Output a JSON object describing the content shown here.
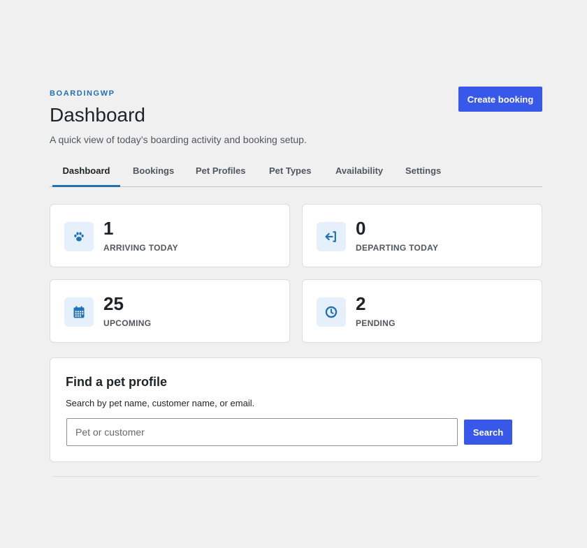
{
  "header": {
    "eyebrow": "BOARDINGWP",
    "title": "Dashboard",
    "subtitle": "A quick view of today’s boarding activity and booking setup.",
    "create_button": "Create booking"
  },
  "tabs": [
    {
      "label": "Dashboard",
      "active": true
    },
    {
      "label": "Bookings"
    },
    {
      "label": "Pet Profiles"
    },
    {
      "label": "Pet Types"
    },
    {
      "label": "Availability"
    },
    {
      "label": "Settings"
    }
  ],
  "stats": [
    {
      "icon": "paw-icon",
      "value": "1",
      "label": "ARRIVING TODAY"
    },
    {
      "icon": "departing-icon",
      "value": "0",
      "label": "DEPARTING TODAY"
    },
    {
      "icon": "calendar-icon",
      "value": "25",
      "label": "UPCOMING"
    },
    {
      "icon": "clock-icon",
      "value": "2",
      "label": "PENDING"
    }
  ],
  "search": {
    "title": "Find a pet profile",
    "description": "Search by pet name, customer name, or email.",
    "placeholder": "Pet or customer",
    "value": "",
    "button": "Search"
  },
  "colors": {
    "accent": "#3858e9",
    "brand": "#2271b1",
    "icon_bg": "#e5f0fa",
    "background": "#f0f0f1"
  }
}
